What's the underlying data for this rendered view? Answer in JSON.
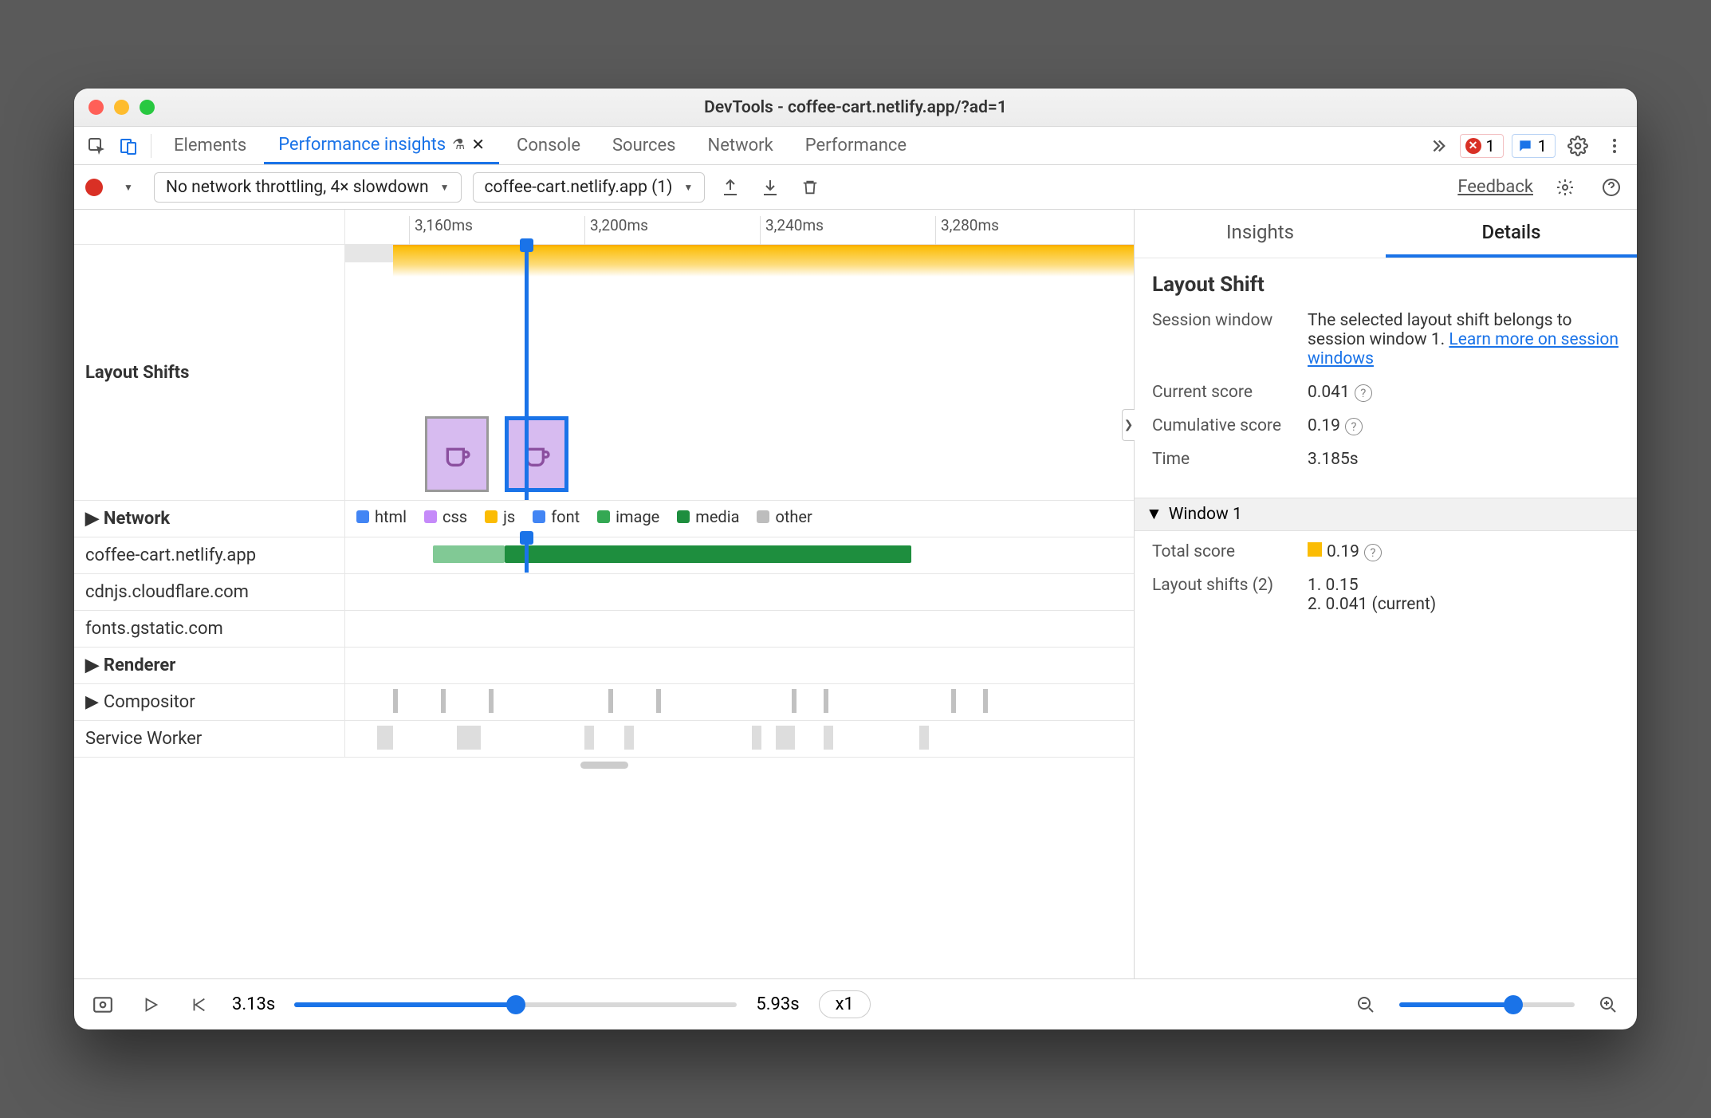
{
  "window": {
    "title": "DevTools - coffee-cart.netlify.app/?ad=1"
  },
  "tabs": {
    "items": [
      "Elements",
      "Performance insights",
      "Console",
      "Sources",
      "Network",
      "Performance"
    ],
    "active_index": 1,
    "errors_count": "1",
    "messages_count": "1"
  },
  "toolbar": {
    "throttle_label": "No network throttling, 4× slowdown",
    "recording_label": "coffee-cart.netlify.app (1)",
    "feedback": "Feedback"
  },
  "ruler": {
    "ticks": [
      "3,160ms",
      "3,200ms",
      "3,240ms",
      "3,280ms"
    ]
  },
  "tracks": {
    "layout_shifts_label": "Layout Shifts",
    "network_label": "Network",
    "network_legend": [
      {
        "label": "html",
        "color": "#4285f4"
      },
      {
        "label": "css",
        "color": "#c58af9"
      },
      {
        "label": "js",
        "color": "#fbbc04"
      },
      {
        "label": "font",
        "color": "#4285f4"
      },
      {
        "label": "image",
        "color": "#34a853"
      },
      {
        "label": "media",
        "color": "#1e8e3e"
      },
      {
        "label": "other",
        "color": "#bdbdbd"
      }
    ],
    "network_hosts": [
      "coffee-cart.netlify.app",
      "cdnjs.cloudflare.com",
      "fonts.gstatic.com"
    ],
    "renderer_label": "Renderer",
    "compositor_label": "Compositor",
    "service_worker_label": "Service Worker"
  },
  "footer": {
    "start_time": "3.13s",
    "end_time": "5.93s",
    "speed": "x1"
  },
  "sidepanel": {
    "tabs": [
      "Insights",
      "Details"
    ],
    "active_tab": 1,
    "heading": "Layout Shift",
    "session_window_label": "Session window",
    "session_window_text_pre": "The selected layout shift belongs to session window 1. ",
    "session_window_link": "Learn more on session windows",
    "current_score_label": "Current score",
    "current_score_value": "0.041",
    "cumulative_score_label": "Cumulative score",
    "cumulative_score_value": "0.19",
    "time_label": "Time",
    "time_value": "3.185s",
    "window1_label": "Window 1",
    "total_score_label": "Total score",
    "total_score_value": "0.19",
    "layout_shifts_label": "Layout shifts (2)",
    "layout_shifts_items": [
      "1. 0.15",
      "2. 0.041 (current)"
    ]
  }
}
